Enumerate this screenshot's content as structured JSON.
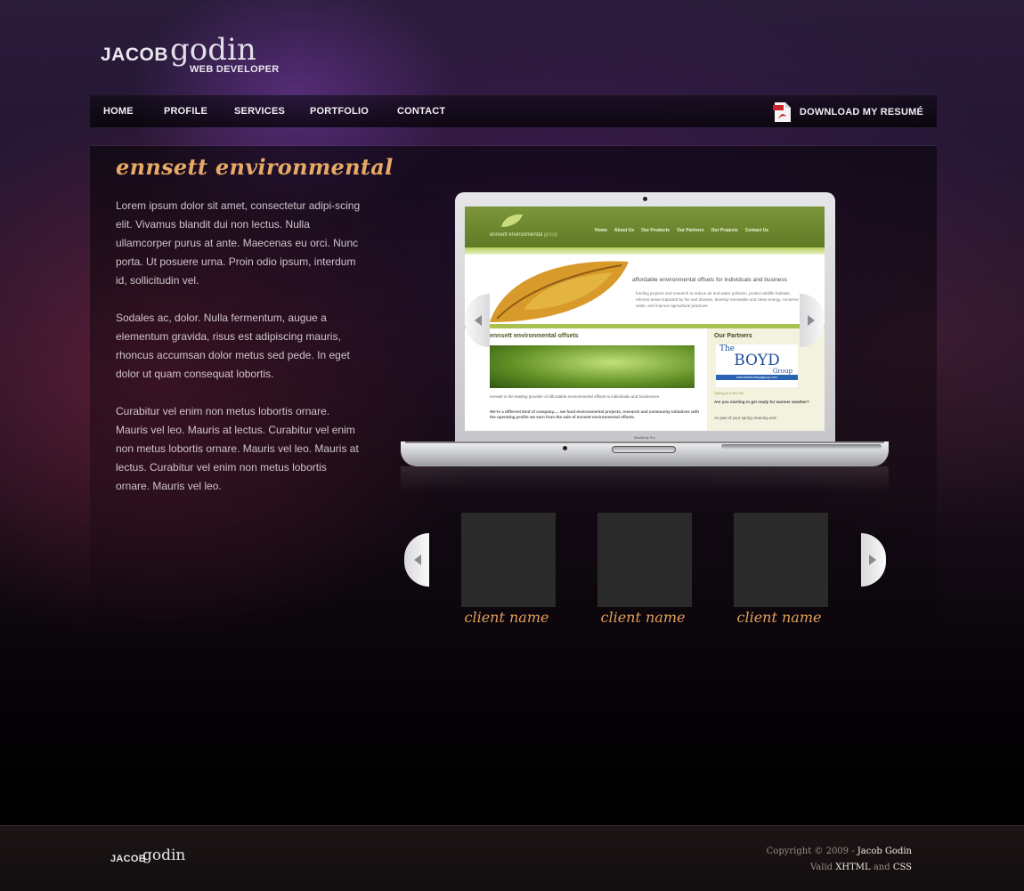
{
  "brand": {
    "first": "JACOB",
    "last": "godin",
    "tagline": "WEB DEVELOPER"
  },
  "nav": {
    "items": [
      {
        "label": "HOME"
      },
      {
        "label": "PROFILE"
      },
      {
        "label": "SERVICES"
      },
      {
        "label": "PORTFOLIO"
      },
      {
        "label": "CONTACT"
      }
    ],
    "resume_label": "DOWNLOAD MY RESUMÉ",
    "pdf_badge": "PDF"
  },
  "project": {
    "title": "ennsett environmental",
    "paragraphs": [
      "Lorem ipsum dolor sit amet, consectetur adipi-scing elit. Vivamus blandit dui non lectus. Nulla ullamcorper purus at ante. Maecenas eu orci. Nunc porta. Ut posuere urna. Proin odio ipsum, interdum id, sollicitudin vel.",
      "Sodales ac, dolor. Nulla fermentum, augue a elementum gravida, risus est adipiscing mauris, rhoncus accumsan dolor metus sed pede. In eget dolor ut quam consequat lobortis.",
      "Curabitur vel enim non metus lobortis ornare. Mauris vel leo. Mauris at lectus. Curabitur vel enim non metus lobortis ornare. Mauris vel leo. Mauris at lectus. Curabitur vel enim non metus lobortis ornare. Mauris vel leo."
    ]
  },
  "preview": {
    "site_name": "ennsett environmental",
    "site_sub": "group",
    "nav": [
      "Home",
      "About Us",
      "Our Products",
      "Our Partners",
      "Our Projects",
      "Contact Us"
    ],
    "hero_text": "affordable environmental offsets for individuals and business",
    "hero_body": "funding projects and research to reduce air and water pollution, protect wildlife habitats, reforest areas impacted by fire and disease, develop renewable and clean energy, conserve water, and improve agricultural practices.",
    "section_title": "ennsett environmental offsets",
    "section_body": "ennsett is the leading provider of affordable environmental offsets to individuals and businesses.",
    "section_body2": "We're a different kind of company..... we fund environmental projects, research and community initiatives with the operating profits we earn from the sale of ennsett environmental offsets.",
    "partners_title": "Our Partners",
    "partner_the": "The",
    "partner_name": "BOYD",
    "partner_group": "Group",
    "partner_url": "www.thedavidboydgroup.com",
    "spring_note": "Spring is in the Air!",
    "warm_note": "Are you starting to get ready for warmer weather?",
    "part_note": "As part of your spring cleaning and",
    "laptop_brand": "MacBook Pro"
  },
  "clients": [
    {
      "label": "client name"
    },
    {
      "label": "client name"
    },
    {
      "label": "client name"
    }
  ],
  "footer": {
    "logo_first": "JACOB",
    "logo_last": "godin",
    "copyright_prefix": "Copyright © 2009 - ",
    "copyright_name": "Jacob Godin",
    "valid_prefix": "Valid ",
    "xhtml": "XHTML",
    "and": " and ",
    "css": "CSS"
  },
  "colors": {
    "accent": "#e7a965",
    "text": "#cfc4cc",
    "thumb": "#2a2a2a",
    "preview_green": "#6f8a2e"
  }
}
